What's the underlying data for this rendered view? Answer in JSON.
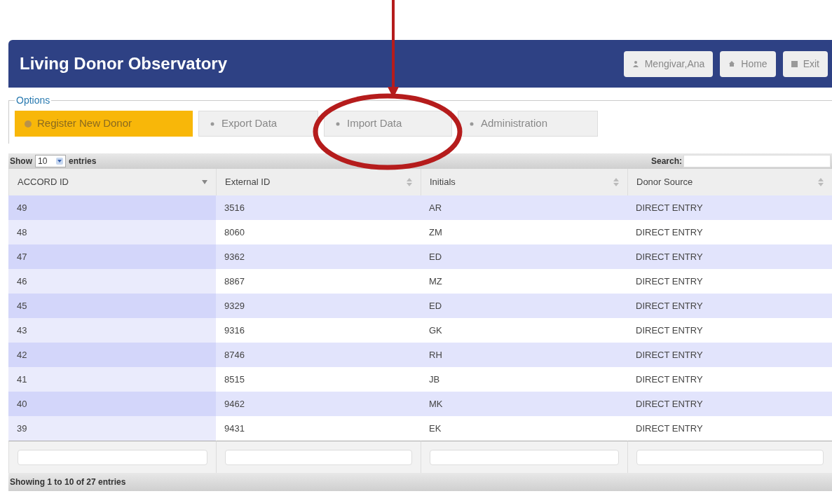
{
  "header": {
    "title": "Living Donor Observatory",
    "buttons": [
      {
        "label": "Mengivar,Ana",
        "kind": "user"
      },
      {
        "label": "Home",
        "kind": "home"
      },
      {
        "label": "Exit",
        "kind": "exit"
      }
    ]
  },
  "options": {
    "legend": "Options",
    "buttons": [
      {
        "label": "Register New Donor",
        "primary": true
      },
      {
        "label": "Export Data",
        "primary": false
      },
      {
        "label": "Import Data",
        "primary": false
      },
      {
        "label": "Administration",
        "primary": false
      }
    ]
  },
  "table": {
    "length": {
      "before": "Show",
      "value": "10",
      "after": "entries"
    },
    "search": {
      "label": "Search:"
    },
    "columns": [
      {
        "label": "ACCORD ID",
        "sorted": true
      },
      {
        "label": "External ID",
        "sorted": false
      },
      {
        "label": "Initials",
        "sorted": false
      },
      {
        "label": "Donor Source",
        "sorted": false
      }
    ],
    "rows": [
      [
        "49",
        "3516",
        "AR",
        "DIRECT ENTRY"
      ],
      [
        "48",
        "8060",
        "ZM",
        "DIRECT ENTRY"
      ],
      [
        "47",
        "9362",
        "ED",
        "DIRECT ENTRY"
      ],
      [
        "46",
        "8867",
        "MZ",
        "DIRECT ENTRY"
      ],
      [
        "45",
        "9329",
        "ED",
        "DIRECT ENTRY"
      ],
      [
        "43",
        "9316",
        "GK",
        "DIRECT ENTRY"
      ],
      [
        "42",
        "8746",
        "RH",
        "DIRECT ENTRY"
      ],
      [
        "41",
        "8515",
        "JB",
        "DIRECT ENTRY"
      ],
      [
        "40",
        "9462",
        "MK",
        "DIRECT ENTRY"
      ],
      [
        "39",
        "9431",
        "EK",
        "DIRECT ENTRY"
      ]
    ],
    "info": "Showing 1 to 10 of 27 entries"
  }
}
